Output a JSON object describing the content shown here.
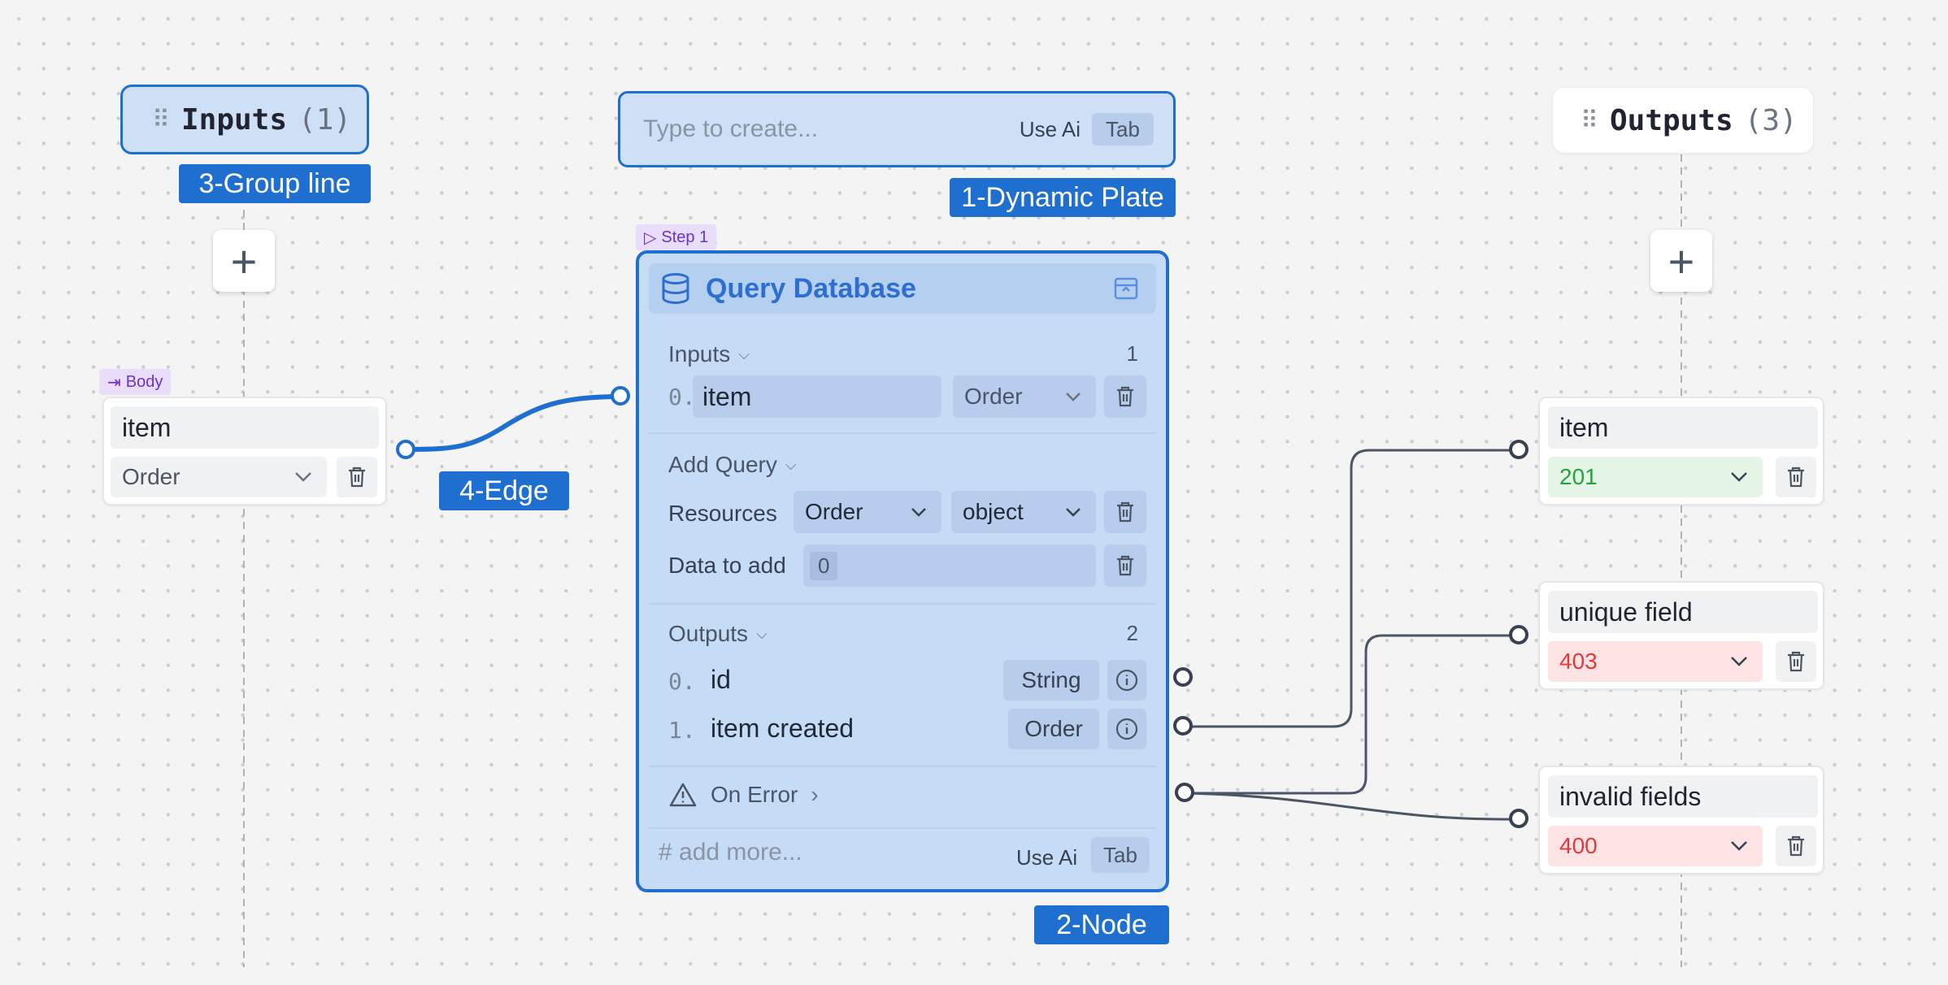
{
  "input_group": {
    "title": "Inputs",
    "count": "(1)"
  },
  "output_group": {
    "title": "Outputs",
    "count": "(3)"
  },
  "tags": {
    "dynamic_plate": "1-Dynamic Plate",
    "node": "2-Node",
    "group_line": "3-Group line",
    "edge": "4-Edge"
  },
  "plate": {
    "placeholder": "Type to create...",
    "use_ai": "Use Ai",
    "tab_key": "Tab"
  },
  "body_badge": "Body",
  "input_param": {
    "name": "item",
    "type": "Order"
  },
  "node": {
    "step_badge": "Step 1",
    "title": "Query Database",
    "inputs_label": "Inputs",
    "inputs_count": "1",
    "input_row": {
      "index": "0.",
      "name": "item",
      "type": "Order"
    },
    "add_query_label": "Add Query",
    "resources_label": "Resources",
    "resources_value1": "Order",
    "resources_value2": "object",
    "data_label": "Data to add",
    "data_value": "0",
    "outputs_label": "Outputs",
    "outputs_count": "2",
    "outputs": [
      {
        "index": "0.",
        "name": "id",
        "type": "String"
      },
      {
        "index": "1.",
        "name": "item created",
        "type": "Order"
      }
    ],
    "on_error": "On Error",
    "add_more_placeholder": "# add more...",
    "use_ai": "Use Ai",
    "tab_key": "Tab"
  },
  "outputs": [
    {
      "name": "item",
      "status": "201",
      "tone": "success"
    },
    {
      "name": "unique field",
      "status": "403",
      "tone": "error"
    },
    {
      "name": "invalid fields",
      "status": "400",
      "tone": "error"
    }
  ],
  "colors": {
    "accent": "#1f6fd1",
    "node_fill": "#c6dbf5",
    "success_bg": "#e4f5e6",
    "success_text": "#23a33a",
    "error_bg": "#fde3e3",
    "error_text": "#e03a3a"
  }
}
